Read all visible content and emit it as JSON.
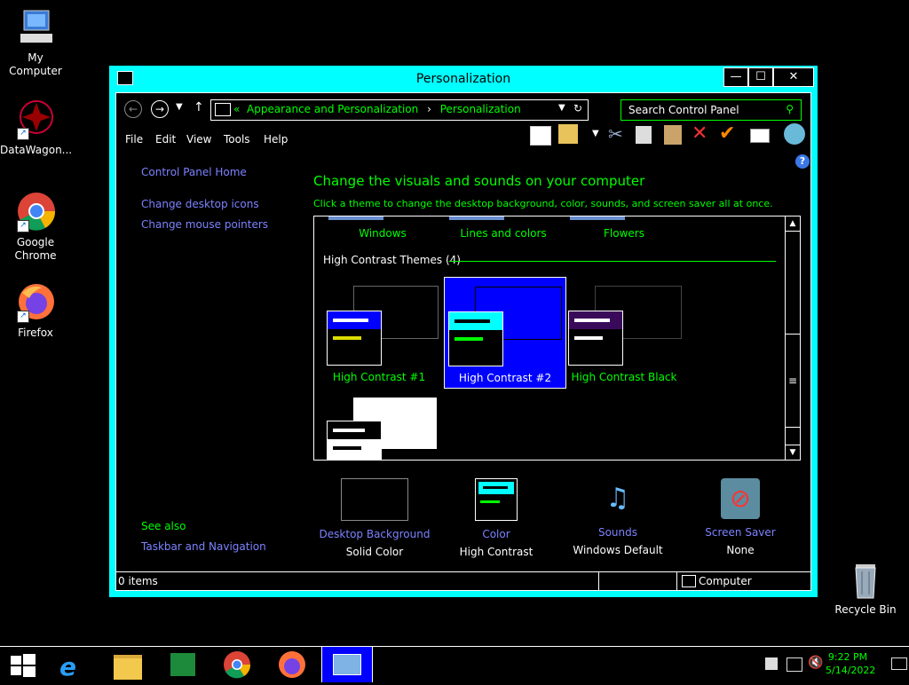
{
  "desktop": {
    "icons": [
      {
        "label": "My Computer"
      },
      {
        "label": "DataWagon..."
      },
      {
        "label": "Google Chrome"
      },
      {
        "label": "Firefox"
      },
      {
        "label": "Recycle Bin"
      }
    ]
  },
  "window": {
    "title": "Personalization",
    "minimize": "—",
    "maximize": "☐",
    "close": "✕",
    "address": {
      "prefix": "«",
      "crumbs": [
        "Appearance and Personalization",
        "Personalization"
      ]
    },
    "search_placeholder": "Search Control Panel",
    "menu": [
      "File",
      "Edit",
      "View",
      "Tools",
      "Help"
    ],
    "sidebar": {
      "links": [
        "Control Panel Home",
        "Change desktop icons",
        "Change mouse pointers"
      ],
      "see_also": "See also",
      "see_also_links": [
        "Taskbar and Navigation"
      ]
    },
    "heading": "Change the visuals and sounds on your computer",
    "subheading": "Click a theme to change the desktop background, color, sounds, and screen saver all at once.",
    "top_themes": [
      "Windows",
      "Lines and colors",
      "Flowers"
    ],
    "hc_group": "High Contrast Themes (4)",
    "hc_themes": [
      "High Contrast #1",
      "High Contrast #2",
      "High Contrast Black"
    ],
    "bottom": [
      {
        "label": "Desktop Background",
        "value": "Solid Color"
      },
      {
        "label": "Color",
        "value": "High Contrast"
      },
      {
        "label": "Sounds",
        "value": "Windows Default"
      },
      {
        "label": "Screen Saver",
        "value": "None"
      }
    ],
    "status": {
      "items": "0 items",
      "location": "Computer"
    }
  },
  "taskbar": {
    "time": "9:22 PM",
    "date": "5/14/2022"
  },
  "colors": {
    "accent": "#00ffff",
    "link": "#7c82ff",
    "text_green": "#00ff00",
    "selected": "#0000ff"
  }
}
